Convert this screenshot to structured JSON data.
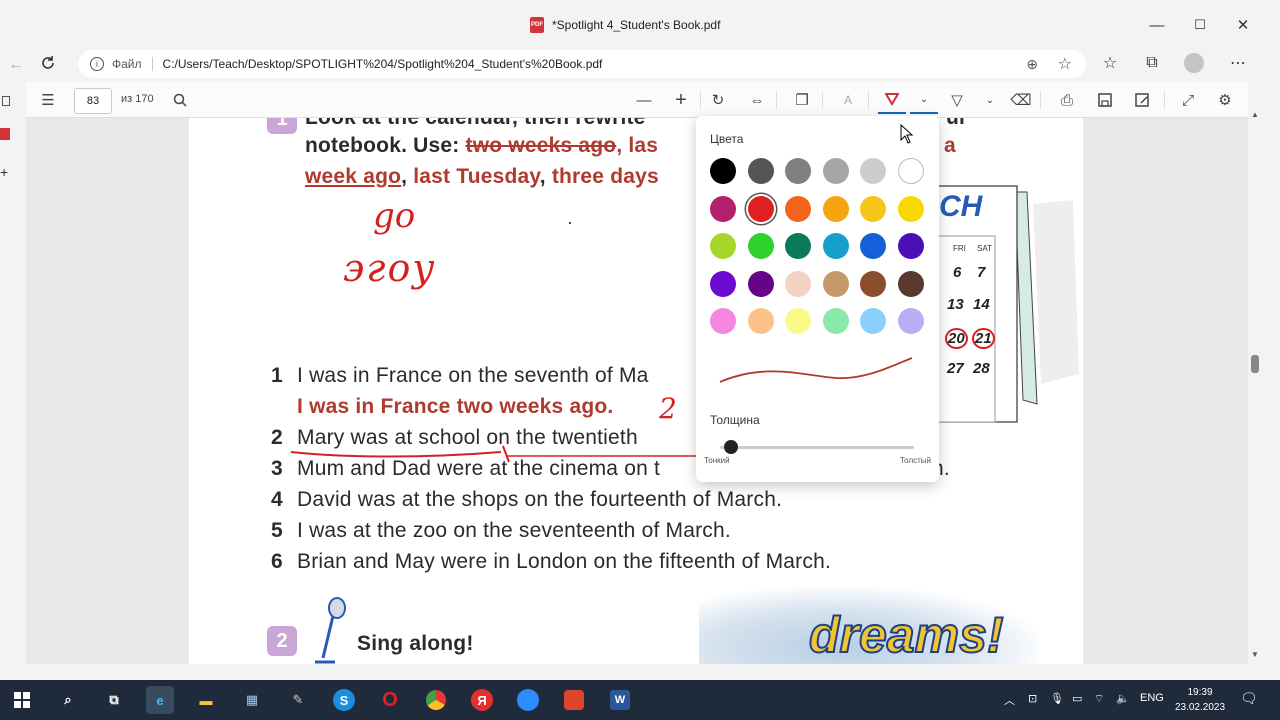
{
  "window": {
    "title": "*Spotlight 4_Student's Book.pdf",
    "minimize": "—",
    "maximize": "☐",
    "close": "✕"
  },
  "address": {
    "file_label": "Файл",
    "url": "C:/Users/Teach/Desktop/SPOTLIGHT%204/Spotlight%204_Student's%20Book.pdf"
  },
  "pdf_toolbar": {
    "page_number": "83",
    "page_count": "из 170"
  },
  "flyout": {
    "colors_label": "Цвета",
    "thickness_label": "Толщина",
    "thin_label": "Тонкий",
    "thick_label": "Толстый",
    "selected_color": "#e02020",
    "thickness_level": 0.02,
    "colors": [
      [
        "#000000",
        "#555555",
        "#808080",
        "#a6a6a6",
        "#cccccc",
        "#ffffff"
      ],
      [
        "#b5206b",
        "#e02020",
        "#f26419",
        "#f5a30f",
        "#f5c518",
        "#f7d800"
      ],
      [
        "#a6d62a",
        "#2ed22e",
        "#0a7a5a",
        "#14a0c8",
        "#1560d8",
        "#4a0fb8"
      ],
      [
        "#6a0ccf",
        "#650585",
        "#f3d3c3",
        "#c49a6c",
        "#8a4f2a",
        "#5a3a2e"
      ],
      [
        "#f587e0",
        "#fbc388",
        "#fafa88",
        "#8ae8a8",
        "#8ad0fa",
        "#b8b0f5"
      ]
    ]
  },
  "page": {
    "task1_line1": "Look at the calendar, then rewrite",
    "task1_line1_end": "ur",
    "task1_line2_a": "notebook. Use: ",
    "task1_line2_b": "two weeks ago",
    "task1_line2_c": ", las",
    "task1_line2_d": "a",
    "task1_line3_a": "week ago",
    "task1_line3_b": ", ",
    "task1_line3_c": "last Tuesday",
    "task1_line3_d": ", ",
    "task1_line3_e": "three days",
    "items": [
      {
        "num": "1",
        "text": "I was in France on the seventh of Ma"
      },
      {
        "num": "",
        "text": "I was in France two weeks ago."
      },
      {
        "num": "2",
        "text": "Mary was at school on the twentieth"
      },
      {
        "num": "3",
        "text": "Mum and Dad were at the cinema on t"
      },
      {
        "num": "4",
        "text": "David was at the shops on the fourteenth of March."
      },
      {
        "num": "5",
        "text": "I was at the zoo on the seventeenth of March."
      },
      {
        "num": "6",
        "text": "Brian and May were in London on the fifteenth of March."
      }
    ],
    "item3_end": "h.",
    "item1_handwriting": "2",
    "task1_badge": "1",
    "task2_badge": "2",
    "task2_title": "Sing along!",
    "handwriting_1": "go",
    "handwriting_2": "эгоу",
    "calendar_title": "CH",
    "calendar_days": [
      "FRI",
      "SAT"
    ],
    "calendar_dates": [
      "6",
      "7",
      "13",
      "14",
      "20",
      "21",
      "27",
      "28"
    ],
    "dreams_word": "dreams!"
  },
  "taskbar": {
    "lang": "ENG",
    "time": "19:39",
    "date": "23.02.2023"
  }
}
